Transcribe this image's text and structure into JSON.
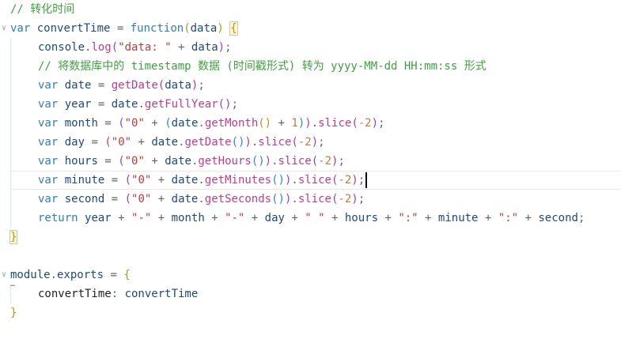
{
  "editor": {
    "lines": [
      [
        {
          "t": "// 转化时间",
          "c": "t-comment"
        }
      ],
      [
        {
          "t": "var",
          "c": "t-kw"
        },
        {
          "t": " ",
          "c": "t-plain"
        },
        {
          "t": "convertTime",
          "c": "t-id"
        },
        {
          "t": " = ",
          "c": "t-op"
        },
        {
          "t": "function",
          "c": "t-kw"
        },
        {
          "t": "(",
          "c": "t-paren1"
        },
        {
          "t": "data",
          "c": "t-id"
        },
        {
          "t": ")",
          "c": "t-paren1"
        },
        {
          "t": " ",
          "c": "t-plain"
        },
        {
          "t": "{",
          "c": "t-paren1",
          "box": true
        }
      ],
      [
        {
          "t": "console",
          "c": "t-id"
        },
        {
          "t": ".",
          "c": "t-op"
        },
        {
          "t": "log",
          "c": "t-method"
        },
        {
          "t": "(",
          "c": "t-paren2"
        },
        {
          "t": "\"data: \"",
          "c": "t-str"
        },
        {
          "t": " + ",
          "c": "t-op"
        },
        {
          "t": "data",
          "c": "t-id"
        },
        {
          "t": ")",
          "c": "t-paren2"
        },
        {
          "t": ";",
          "c": "t-op"
        }
      ],
      [
        {
          "t": "// 将数据库中的 timestamp 数据 (时间戳形式) 转为 yyyy-MM-dd HH:mm:ss 形式",
          "c": "t-comment"
        }
      ],
      [
        {
          "t": "var",
          "c": "t-kw"
        },
        {
          "t": " ",
          "c": "t-plain"
        },
        {
          "t": "date",
          "c": "t-id"
        },
        {
          "t": " = ",
          "c": "t-op"
        },
        {
          "t": "getDate",
          "c": "t-method"
        },
        {
          "t": "(",
          "c": "t-paren2"
        },
        {
          "t": "data",
          "c": "t-id"
        },
        {
          "t": ")",
          "c": "t-paren2"
        },
        {
          "t": ";",
          "c": "t-op"
        }
      ],
      [
        {
          "t": "var",
          "c": "t-kw"
        },
        {
          "t": " ",
          "c": "t-plain"
        },
        {
          "t": "year",
          "c": "t-id"
        },
        {
          "t": " = ",
          "c": "t-op"
        },
        {
          "t": "date",
          "c": "t-id"
        },
        {
          "t": ".",
          "c": "t-op"
        },
        {
          "t": "getFullYear",
          "c": "t-method"
        },
        {
          "t": "()",
          "c": "t-paren2"
        },
        {
          "t": ";",
          "c": "t-op"
        }
      ],
      [
        {
          "t": "var",
          "c": "t-kw"
        },
        {
          "t": " ",
          "c": "t-plain"
        },
        {
          "t": "month",
          "c": "t-id"
        },
        {
          "t": " = ",
          "c": "t-op"
        },
        {
          "t": "(",
          "c": "t-paren2"
        },
        {
          "t": "\"0\"",
          "c": "t-str"
        },
        {
          "t": " + ",
          "c": "t-op"
        },
        {
          "t": "(",
          "c": "t-paren3"
        },
        {
          "t": "date",
          "c": "t-id"
        },
        {
          "t": ".",
          "c": "t-op"
        },
        {
          "t": "getMonth",
          "c": "t-method"
        },
        {
          "t": "()",
          "c": "t-paren1"
        },
        {
          "t": " + ",
          "c": "t-op"
        },
        {
          "t": "1",
          "c": "t-num"
        },
        {
          "t": ")",
          "c": "t-paren3"
        },
        {
          "t": ")",
          "c": "t-paren2"
        },
        {
          "t": ".",
          "c": "t-op"
        },
        {
          "t": "slice",
          "c": "t-method"
        },
        {
          "t": "(",
          "c": "t-paren2"
        },
        {
          "t": "-2",
          "c": "t-num"
        },
        {
          "t": ")",
          "c": "t-paren2"
        },
        {
          "t": ";",
          "c": "t-op"
        }
      ],
      [
        {
          "t": "var",
          "c": "t-kw"
        },
        {
          "t": " ",
          "c": "t-plain"
        },
        {
          "t": "day",
          "c": "t-id"
        },
        {
          "t": " = ",
          "c": "t-op"
        },
        {
          "t": "(",
          "c": "t-paren2"
        },
        {
          "t": "\"0\"",
          "c": "t-str"
        },
        {
          "t": " + ",
          "c": "t-op"
        },
        {
          "t": "date",
          "c": "t-id"
        },
        {
          "t": ".",
          "c": "t-op"
        },
        {
          "t": "getDate",
          "c": "t-method"
        },
        {
          "t": "()",
          "c": "t-paren3"
        },
        {
          "t": ")",
          "c": "t-paren2"
        },
        {
          "t": ".",
          "c": "t-op"
        },
        {
          "t": "slice",
          "c": "t-method"
        },
        {
          "t": "(",
          "c": "t-paren2"
        },
        {
          "t": "-2",
          "c": "t-num"
        },
        {
          "t": ")",
          "c": "t-paren2"
        },
        {
          "t": ";",
          "c": "t-op"
        }
      ],
      [
        {
          "t": "var",
          "c": "t-kw"
        },
        {
          "t": " ",
          "c": "t-plain"
        },
        {
          "t": "hours",
          "c": "t-id"
        },
        {
          "t": " = ",
          "c": "t-op"
        },
        {
          "t": "(",
          "c": "t-paren2"
        },
        {
          "t": "\"0\"",
          "c": "t-str"
        },
        {
          "t": " + ",
          "c": "t-op"
        },
        {
          "t": "date",
          "c": "t-id"
        },
        {
          "t": ".",
          "c": "t-op"
        },
        {
          "t": "getHours",
          "c": "t-method"
        },
        {
          "t": "()",
          "c": "t-paren3"
        },
        {
          "t": ")",
          "c": "t-paren2"
        },
        {
          "t": ".",
          "c": "t-op"
        },
        {
          "t": "slice",
          "c": "t-method"
        },
        {
          "t": "(",
          "c": "t-paren2"
        },
        {
          "t": "-2",
          "c": "t-num"
        },
        {
          "t": ")",
          "c": "t-paren2"
        },
        {
          "t": ";",
          "c": "t-op"
        }
      ],
      [
        {
          "t": "var",
          "c": "t-kw"
        },
        {
          "t": " ",
          "c": "t-plain"
        },
        {
          "t": "minute",
          "c": "t-id"
        },
        {
          "t": " = ",
          "c": "t-op"
        },
        {
          "t": "(",
          "c": "t-paren2"
        },
        {
          "t": "\"0\"",
          "c": "t-str"
        },
        {
          "t": " + ",
          "c": "t-op"
        },
        {
          "t": "date",
          "c": "t-id"
        },
        {
          "t": ".",
          "c": "t-op"
        },
        {
          "t": "getMinutes",
          "c": "t-method"
        },
        {
          "t": "()",
          "c": "t-paren3"
        },
        {
          "t": ")",
          "c": "t-paren2"
        },
        {
          "t": ".",
          "c": "t-op"
        },
        {
          "t": "slice",
          "c": "t-method"
        },
        {
          "t": "(",
          "c": "t-paren2"
        },
        {
          "t": "-2",
          "c": "t-num"
        },
        {
          "t": ")",
          "c": "t-paren2"
        },
        {
          "t": ";",
          "c": "t-op"
        }
      ],
      [
        {
          "t": "var",
          "c": "t-kw"
        },
        {
          "t": " ",
          "c": "t-plain"
        },
        {
          "t": "second",
          "c": "t-id"
        },
        {
          "t": " = ",
          "c": "t-op"
        },
        {
          "t": "(",
          "c": "t-paren2"
        },
        {
          "t": "\"0\"",
          "c": "t-str"
        },
        {
          "t": " + ",
          "c": "t-op"
        },
        {
          "t": "date",
          "c": "t-id"
        },
        {
          "t": ".",
          "c": "t-op"
        },
        {
          "t": "getSeconds",
          "c": "t-method"
        },
        {
          "t": "()",
          "c": "t-paren3"
        },
        {
          "t": ")",
          "c": "t-paren2"
        },
        {
          "t": ".",
          "c": "t-op"
        },
        {
          "t": "slice",
          "c": "t-method"
        },
        {
          "t": "(",
          "c": "t-paren2"
        },
        {
          "t": "-2",
          "c": "t-num"
        },
        {
          "t": ")",
          "c": "t-paren2"
        },
        {
          "t": ";",
          "c": "t-op"
        }
      ],
      [
        {
          "t": "return",
          "c": "t-kw"
        },
        {
          "t": " ",
          "c": "t-plain"
        },
        {
          "t": "year",
          "c": "t-id"
        },
        {
          "t": " + ",
          "c": "t-op"
        },
        {
          "t": "\"-\"",
          "c": "t-str"
        },
        {
          "t": " + ",
          "c": "t-op"
        },
        {
          "t": "month",
          "c": "t-id"
        },
        {
          "t": " + ",
          "c": "t-op"
        },
        {
          "t": "\"-\"",
          "c": "t-str"
        },
        {
          "t": " + ",
          "c": "t-op"
        },
        {
          "t": "day",
          "c": "t-id"
        },
        {
          "t": " + ",
          "c": "t-op"
        },
        {
          "t": "\" \"",
          "c": "t-str"
        },
        {
          "t": " + ",
          "c": "t-op"
        },
        {
          "t": "hours",
          "c": "t-id"
        },
        {
          "t": " + ",
          "c": "t-op"
        },
        {
          "t": "\":\"",
          "c": "t-str"
        },
        {
          "t": " + ",
          "c": "t-op"
        },
        {
          "t": "minute",
          "c": "t-id"
        },
        {
          "t": " + ",
          "c": "t-op"
        },
        {
          "t": "\":\"",
          "c": "t-str"
        },
        {
          "t": " + ",
          "c": "t-op"
        },
        {
          "t": "second",
          "c": "t-id"
        },
        {
          "t": ";",
          "c": "t-op"
        }
      ],
      [
        {
          "t": "}",
          "c": "t-paren1",
          "box": true
        }
      ],
      [],
      [
        {
          "t": "module",
          "c": "t-id"
        },
        {
          "t": ".",
          "c": "t-op"
        },
        {
          "t": "exports",
          "c": "t-id"
        },
        {
          "t": " = ",
          "c": "t-op"
        },
        {
          "t": "{",
          "c": "t-paren1"
        }
      ],
      [
        {
          "t": "convertTime",
          "c": "t-plain"
        },
        {
          "t": ": ",
          "c": "t-op"
        },
        {
          "t": "convertTime",
          "c": "t-id"
        }
      ],
      [
        {
          "t": "}",
          "c": "t-paren1"
        }
      ]
    ]
  }
}
